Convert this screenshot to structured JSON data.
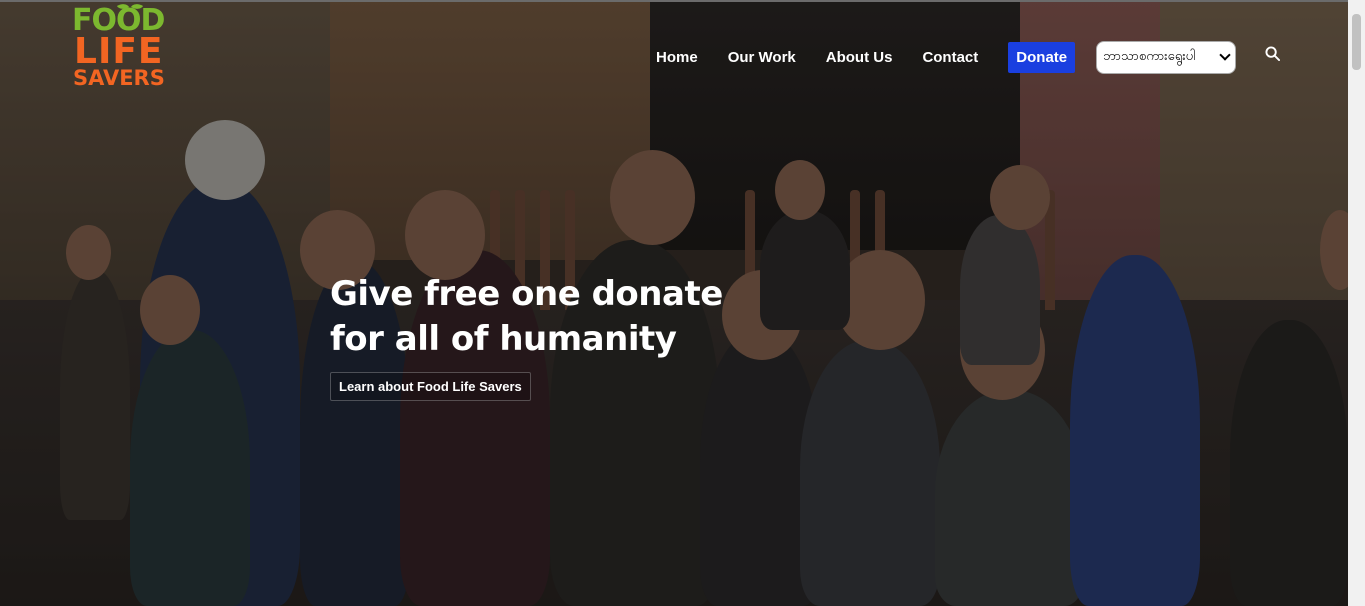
{
  "logo": {
    "line1": "FOOD",
    "line2": "LIFE",
    "line3": "SAVERS",
    "colors": {
      "green": "#7cb82f",
      "orange": "#f26522"
    }
  },
  "nav": {
    "items": [
      {
        "label": "Home"
      },
      {
        "label": "Our Work"
      },
      {
        "label": "About Us"
      },
      {
        "label": "Contact"
      }
    ],
    "donate_label": "Donate",
    "donate_color": "#1a3fe0",
    "language_select": {
      "selected": "ဘာသာစကားရွေးပါ"
    },
    "search_icon": "search-icon"
  },
  "hero": {
    "title": "Give free one donate for all of humanity",
    "cta_label": "Learn about Food Life Savers"
  }
}
